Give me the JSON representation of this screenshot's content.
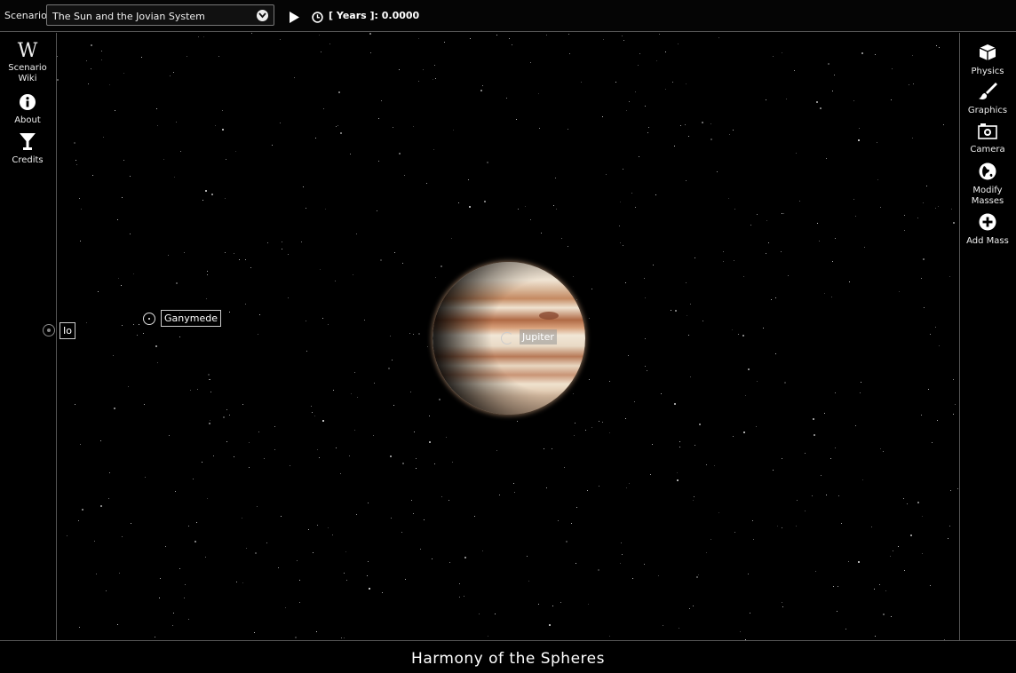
{
  "topbar": {
    "scenario_label": "Scenario",
    "scenario_value": "The Sun and the Jovian System",
    "time_readout": "[ Years ]: 0.0000"
  },
  "left_menu": [
    {
      "label_line1": "Scenario",
      "label_line2": "Wiki",
      "icon": "wikipedia-icon"
    },
    {
      "label_line1": "About",
      "label_line2": "",
      "icon": "info-icon"
    },
    {
      "label_line1": "Credits",
      "label_line2": "",
      "icon": "cocktail-glass-icon"
    }
  ],
  "right_menu": [
    {
      "label_line1": "Physics",
      "label_line2": "",
      "icon": "cube-icon"
    },
    {
      "label_line1": "Graphics",
      "label_line2": "",
      "icon": "paintbrush-icon"
    },
    {
      "label_line1": "Camera",
      "label_line2": "",
      "icon": "camera-icon"
    },
    {
      "label_line1": "Modify",
      "label_line2": "Masses",
      "icon": "globe-icon"
    },
    {
      "label_line1": "Add Mass",
      "label_line2": "",
      "icon": "plus-circle-icon"
    }
  ],
  "bodies": {
    "jupiter": "Jupiter",
    "ganymede": "Ganymede",
    "io": "Io"
  },
  "footer": {
    "title": "Harmony of the Spheres"
  }
}
